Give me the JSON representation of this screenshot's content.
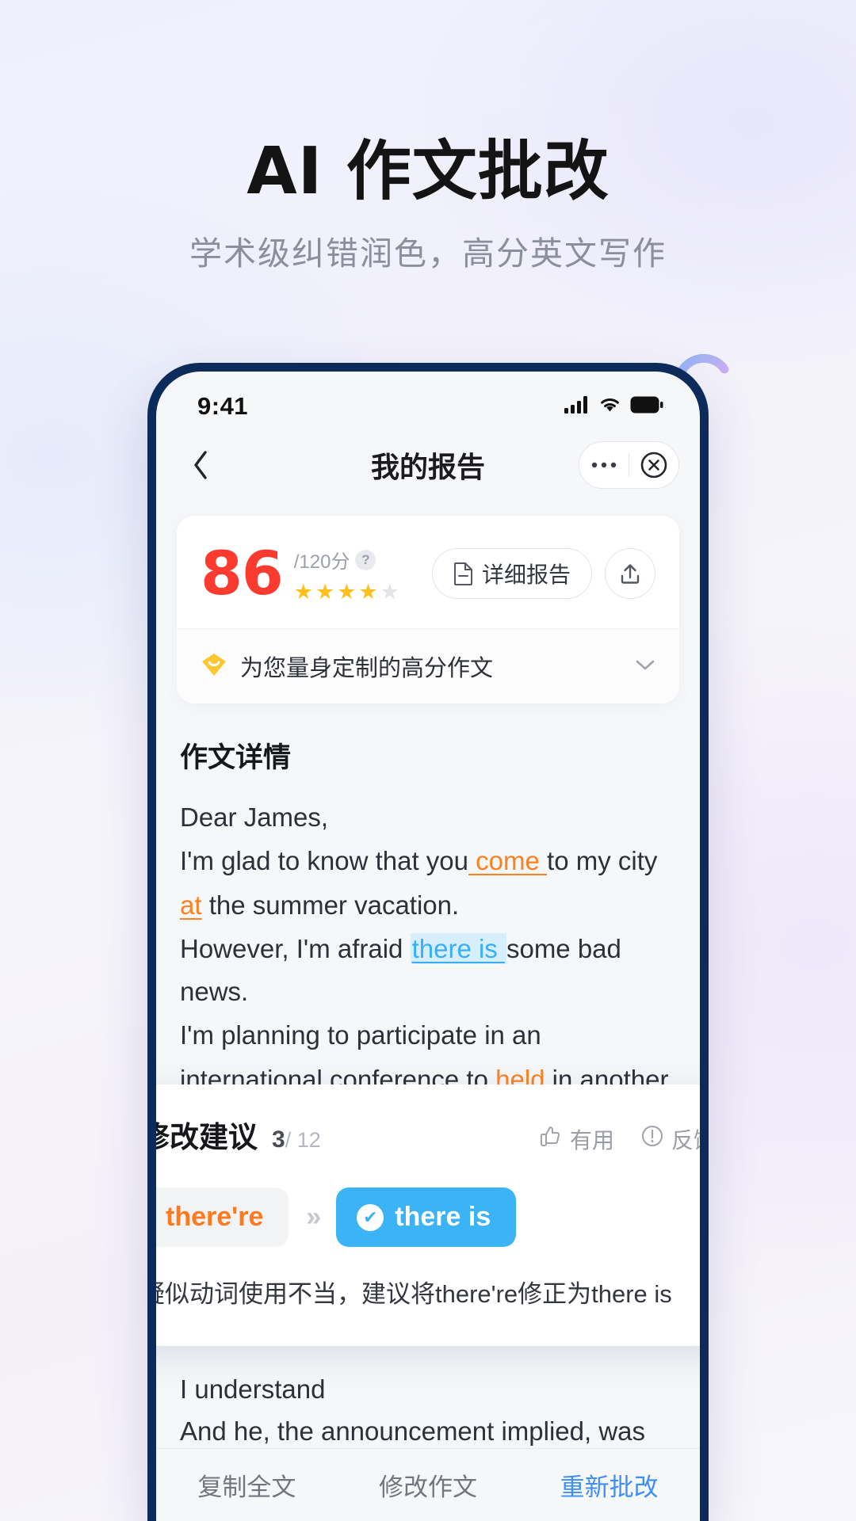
{
  "hero": {
    "title": "AI 作文批改",
    "subtitle": "学术级纠错润色，高分英文写作"
  },
  "phone": {
    "status": {
      "time": "9:41",
      "icons": [
        "signal-icon",
        "wifi-icon",
        "battery-icon"
      ]
    },
    "navbar": {
      "back": "back-chevron-icon",
      "title": "我的报告",
      "more": "more-dots-icon",
      "close": "close-circle-icon"
    },
    "score_card": {
      "score": "86",
      "denominator": "/120分",
      "help": "?",
      "stars_filled": 4,
      "stars_total": 5,
      "star_glyph": "★",
      "detail_report_label": "详细报告",
      "detail_report_icon": "document-icon",
      "share_icon": "share-upload-icon",
      "banner_icon": "smile-badge-icon",
      "banner_text": "为您量身定制的高分作文",
      "banner_chevron": "chevron-down-icon"
    },
    "essay": {
      "heading": "作文详情",
      "lines": [
        {
          "parts": [
            {
              "t": "Dear James,",
              "k": "plain"
            }
          ]
        },
        {
          "parts": [
            {
              "t": "I'm glad to know that you",
              "k": "plain"
            },
            {
              "t": " come ",
              "k": "corr"
            },
            {
              "t": "to my city",
              "k": "plain"
            }
          ]
        },
        {
          "parts": [
            {
              "t": "at",
              "k": "corr"
            },
            {
              "t": " the summer vacation.",
              "k": "plain"
            }
          ]
        },
        {
          "parts": [
            {
              "t": "However, I'm afraid ",
              "k": "plain"
            },
            {
              "t": "there is ",
              "k": "hl"
            },
            {
              "t": "some bad news.",
              "k": "plain"
            }
          ]
        },
        {
          "parts": [
            {
              "t": "I'm planning to participate in an",
              "k": "plain"
            }
          ]
        },
        {
          "parts": [
            {
              "t": "international conference to ",
              "k": "plain"
            },
            {
              "t": "held",
              "k": "corr"
            },
            {
              "t": " in another",
              "k": "plain"
            }
          ]
        }
      ],
      "tail_lines": [
        "I understand",
        "And he, the announcement implied, was"
      ]
    },
    "suggestion": {
      "title": "修改建议",
      "index": "3",
      "total": "/ 12",
      "useful_label": "有用",
      "useful_icon": "thumbs-up-icon",
      "feedback_label": "反馈",
      "feedback_icon": "alert-circle-icon",
      "original": "there're",
      "arrow": "»",
      "replacement": "there is",
      "check_icon": "check-circle-icon",
      "description": "疑似动词使用不当，建议将there're修正为there is"
    },
    "bottom_bar": {
      "items": [
        {
          "label": "复制全文",
          "primary": false
        },
        {
          "label": "修改作文",
          "primary": false
        },
        {
          "label": "重新批改",
          "primary": true
        }
      ]
    }
  },
  "colors": {
    "accent_red": "#fb3b30",
    "accent_blue": "#3cb3f5",
    "accent_orange": "#ff7a1f",
    "star_yellow": "#ffc01e",
    "phone_frame": "#0c2a5a",
    "primary_link": "#3d8ef7"
  }
}
